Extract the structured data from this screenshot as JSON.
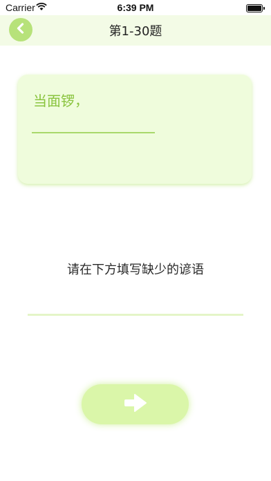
{
  "status": {
    "carrier": "Carrier",
    "time": "6:39 PM"
  },
  "nav": {
    "title": "第1-30题",
    "back_icon": "chevron-left-icon"
  },
  "question": {
    "text": "当面锣，"
  },
  "prompt": "请在下方填写缺少的谚语",
  "answer": {
    "value": "",
    "placeholder": ""
  },
  "next": {
    "icon": "arrow-right-icon"
  },
  "colors": {
    "accent": "#8ac43f",
    "card_bg": "#effcdc",
    "nav_bg": "#f3fbe6",
    "button_bg": "#daf6a9"
  }
}
